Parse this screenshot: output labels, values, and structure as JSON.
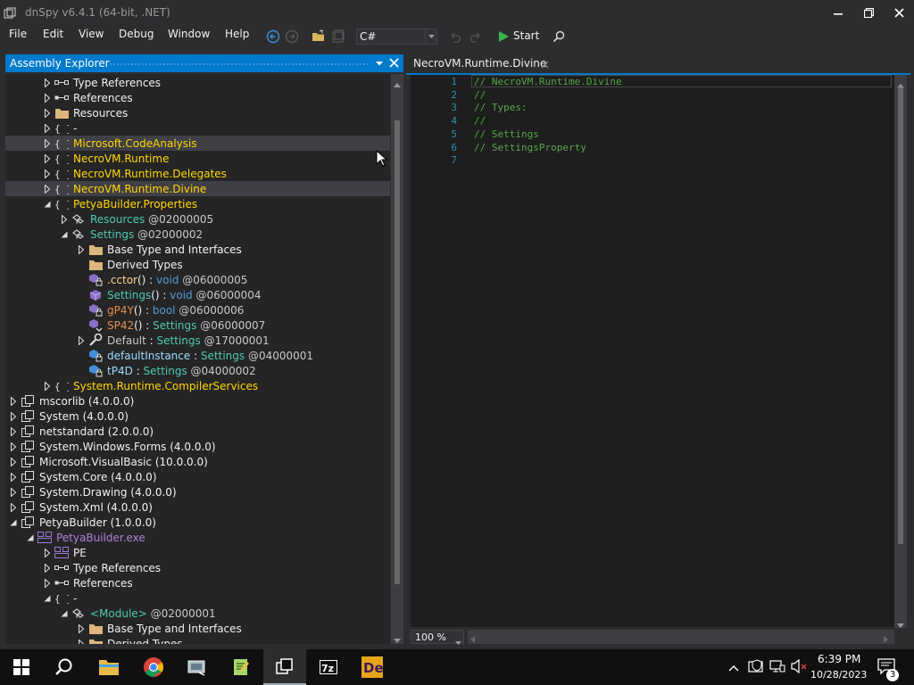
{
  "window": {
    "title": "dnSpy v6.4.1 (64-bit, .NET)"
  },
  "menu": [
    "File",
    "Edit",
    "View",
    "Debug",
    "Window",
    "Help"
  ],
  "toolbar": {
    "language": "C#",
    "start_label": "Start"
  },
  "assembly_explorer": {
    "title": "Assembly Explorer",
    "rows": [
      {
        "level": 2,
        "toggle": "collapsed",
        "icon": "type-references-icon",
        "segments": [
          {
            "t": "Type References",
            "c": "#f1f1f1"
          }
        ]
      },
      {
        "level": 2,
        "toggle": "collapsed",
        "icon": "references-icon",
        "segments": [
          {
            "t": "References",
            "c": "#f1f1f1"
          }
        ]
      },
      {
        "level": 2,
        "toggle": "collapsed",
        "icon": "folder-icon",
        "segments": [
          {
            "t": "Resources",
            "c": "#f1f1f1"
          }
        ]
      },
      {
        "level": 2,
        "toggle": "collapsed",
        "icon": "namespace-icon",
        "segments": [
          {
            "t": "-",
            "c": "#f1f1f1"
          }
        ]
      },
      {
        "level": 2,
        "toggle": "collapsed",
        "icon": "namespace-icon",
        "selected": true,
        "segments": [
          {
            "t": "Microsoft.CodeAnalysis",
            "c": "#ffd700"
          }
        ]
      },
      {
        "level": 2,
        "toggle": "collapsed",
        "icon": "namespace-icon",
        "segments": [
          {
            "t": "NecroVM.Runtime",
            "c": "#ffd700"
          }
        ]
      },
      {
        "level": 2,
        "toggle": "collapsed",
        "icon": "namespace-icon",
        "segments": [
          {
            "t": "NecroVM.Runtime.Delegates",
            "c": "#ffd700"
          }
        ]
      },
      {
        "level": 2,
        "toggle": "collapsed",
        "icon": "namespace-icon",
        "selected": true,
        "segments": [
          {
            "t": "NecroVM.Runtime.Divine",
            "c": "#ffd700"
          }
        ]
      },
      {
        "level": 2,
        "toggle": "expanded",
        "icon": "namespace-icon",
        "segments": [
          {
            "t": "PetyaBuilder.Properties",
            "c": "#ffd700"
          }
        ]
      },
      {
        "level": 3,
        "toggle": "collapsed",
        "icon": "class-icon",
        "segments": [
          {
            "t": "Resources",
            "c": "#4ec9b0"
          },
          {
            "t": " @02000005",
            "c": "#c8c8c8"
          }
        ]
      },
      {
        "level": 3,
        "toggle": "expanded",
        "icon": "class-icon",
        "segments": [
          {
            "t": "Settings",
            "c": "#4ec9b0"
          },
          {
            "t": " @02000002",
            "c": "#c8c8c8"
          }
        ]
      },
      {
        "level": 4,
        "toggle": "collapsed",
        "icon": "folder-icon",
        "segments": [
          {
            "t": "Base Type and Interfaces",
            "c": "#f1f1f1"
          }
        ]
      },
      {
        "level": 4,
        "toggle": "none",
        "icon": "folder-icon",
        "segments": [
          {
            "t": "Derived Types",
            "c": "#f1f1f1"
          }
        ]
      },
      {
        "level": 4,
        "toggle": "none",
        "icon": "private-method-icon",
        "segments": [
          {
            "t": ".cctor",
            "c": "#ffd68f"
          },
          {
            "t": "() : ",
            "c": "#f1f1f1"
          },
          {
            "t": "void",
            "c": "#569cd6"
          },
          {
            "t": " @06000005",
            "c": "#c8c8c8"
          }
        ]
      },
      {
        "level": 4,
        "toggle": "none",
        "icon": "method-icon",
        "segments": [
          {
            "t": "Settings",
            "c": "#4ec9b0"
          },
          {
            "t": "() : ",
            "c": "#f1f1f1"
          },
          {
            "t": "void",
            "c": "#569cd6"
          },
          {
            "t": " @06000004",
            "c": "#c8c8c8"
          }
        ]
      },
      {
        "level": 4,
        "toggle": "none",
        "icon": "private-method-icon",
        "segments": [
          {
            "t": "gP4Y",
            "c": "#e6904c"
          },
          {
            "t": "() : ",
            "c": "#f1f1f1"
          },
          {
            "t": "bool",
            "c": "#569cd6"
          },
          {
            "t": " @06000006",
            "c": "#c8c8c8"
          }
        ]
      },
      {
        "level": 4,
        "toggle": "none",
        "icon": "internal-method-icon",
        "segments": [
          {
            "t": "SP42",
            "c": "#e6904c"
          },
          {
            "t": "() : ",
            "c": "#f1f1f1"
          },
          {
            "t": "Settings",
            "c": "#4ec9b0"
          },
          {
            "t": " @06000007",
            "c": "#c8c8c8"
          }
        ]
      },
      {
        "level": 4,
        "toggle": "collapsed",
        "icon": "property-wrench-icon",
        "segments": [
          {
            "t": "Default",
            "c": "#c8c8c8"
          },
          {
            "t": " : ",
            "c": "#f1f1f1"
          },
          {
            "t": "Settings",
            "c": "#4ec9b0"
          },
          {
            "t": " @17000001",
            "c": "#c8c8c8"
          }
        ]
      },
      {
        "level": 4,
        "toggle": "none",
        "icon": "private-field-icon",
        "segments": [
          {
            "t": "defaultInstance",
            "c": "#9cdcfe"
          },
          {
            "t": " : ",
            "c": "#f1f1f1"
          },
          {
            "t": "Settings",
            "c": "#4ec9b0"
          },
          {
            "t": " @04000001",
            "c": "#c8c8c8"
          }
        ]
      },
      {
        "level": 4,
        "toggle": "none",
        "icon": "private-field-icon",
        "segments": [
          {
            "t": "tP4D",
            "c": "#9cdcfe"
          },
          {
            "t": " : ",
            "c": "#f1f1f1"
          },
          {
            "t": "Settings",
            "c": "#4ec9b0"
          },
          {
            "t": " @04000002",
            "c": "#c8c8c8"
          }
        ]
      },
      {
        "level": 2,
        "toggle": "collapsed",
        "icon": "namespace-icon",
        "segments": [
          {
            "t": "System.Runtime.CompilerServices",
            "c": "#ffd700"
          }
        ]
      },
      {
        "level": 0,
        "toggle": "collapsed",
        "icon": "assembly-icon",
        "segments": [
          {
            "t": "mscorlib (4.0.0.0)",
            "c": "#f1f1f1"
          }
        ]
      },
      {
        "level": 0,
        "toggle": "collapsed",
        "icon": "assembly-icon",
        "segments": [
          {
            "t": "System (4.0.0.0)",
            "c": "#f1f1f1"
          }
        ]
      },
      {
        "level": 0,
        "toggle": "collapsed",
        "icon": "assembly-icon",
        "segments": [
          {
            "t": "netstandard (2.0.0.0)",
            "c": "#f1f1f1"
          }
        ]
      },
      {
        "level": 0,
        "toggle": "collapsed",
        "icon": "assembly-icon",
        "segments": [
          {
            "t": "System.Windows.Forms (4.0.0.0)",
            "c": "#f1f1f1"
          }
        ]
      },
      {
        "level": 0,
        "toggle": "collapsed",
        "icon": "assembly-icon",
        "segments": [
          {
            "t": "Microsoft.VisualBasic (10.0.0.0)",
            "c": "#f1f1f1"
          }
        ]
      },
      {
        "level": 0,
        "toggle": "collapsed",
        "icon": "assembly-icon",
        "segments": [
          {
            "t": "System.Core (4.0.0.0)",
            "c": "#f1f1f1"
          }
        ]
      },
      {
        "level": 0,
        "toggle": "collapsed",
        "icon": "assembly-icon",
        "segments": [
          {
            "t": "System.Drawing (4.0.0.0)",
            "c": "#f1f1f1"
          }
        ]
      },
      {
        "level": 0,
        "toggle": "collapsed",
        "icon": "assembly-icon",
        "segments": [
          {
            "t": "System.Xml (4.0.0.0)",
            "c": "#f1f1f1"
          }
        ]
      },
      {
        "level": 0,
        "toggle": "expanded",
        "icon": "assembly-icon",
        "segments": [
          {
            "t": "PetyaBuilder (1.0.0.0)",
            "c": "#f1f1f1"
          }
        ]
      },
      {
        "level": 1,
        "toggle": "expanded",
        "icon": "module-icon",
        "segments": [
          {
            "t": "PetyaBuilder.exe",
            "c": "#b180d7"
          }
        ]
      },
      {
        "level": 2,
        "toggle": "collapsed",
        "icon": "pe-icon",
        "segments": [
          {
            "t": "PE",
            "c": "#f1f1f1"
          }
        ]
      },
      {
        "level": 2,
        "toggle": "collapsed",
        "icon": "type-references-icon",
        "segments": [
          {
            "t": "Type References",
            "c": "#f1f1f1"
          }
        ]
      },
      {
        "level": 2,
        "toggle": "collapsed",
        "icon": "references-icon",
        "segments": [
          {
            "t": "References",
            "c": "#f1f1f1"
          }
        ]
      },
      {
        "level": 2,
        "toggle": "expanded",
        "icon": "namespace-icon",
        "segments": [
          {
            "t": "-",
            "c": "#f1f1f1"
          }
        ]
      },
      {
        "level": 3,
        "toggle": "expanded",
        "icon": "class-icon",
        "segments": [
          {
            "t": "<Module>",
            "c": "#4ec9b0"
          },
          {
            "t": " @02000001",
            "c": "#c8c8c8"
          }
        ]
      },
      {
        "level": 4,
        "toggle": "collapsed",
        "icon": "folder-icon",
        "segments": [
          {
            "t": "Base Type and Interfaces",
            "c": "#f1f1f1"
          }
        ]
      },
      {
        "level": 4,
        "toggle": "collapsed",
        "icon": "folder-icon",
        "segments": [
          {
            "t": "Derived Types",
            "c": "#f1f1f1"
          }
        ]
      }
    ]
  },
  "editor": {
    "tab_title": "NecroVM.Runtime.Divine",
    "lines": [
      {
        "n": "1",
        "text": "// NecroVM.Runtime.Divine"
      },
      {
        "n": "2",
        "text": "//"
      },
      {
        "n": "3",
        "text": "// Types:"
      },
      {
        "n": "4",
        "text": "//"
      },
      {
        "n": "5",
        "text": "// Settings"
      },
      {
        "n": "6",
        "text": "// SettingsProperty"
      },
      {
        "n": "7",
        "text": ""
      }
    ],
    "zoom": "100 %"
  },
  "taskbar": {
    "time": "6:39 PM",
    "date": "10/28/2023",
    "notification_count": "3"
  },
  "colors": {
    "accent": "#007acc",
    "namespace": "#ffd700",
    "type": "#4ec9b0",
    "keyword": "#569cd6",
    "comment": "#57a64a",
    "line_number": "#2b91af"
  }
}
